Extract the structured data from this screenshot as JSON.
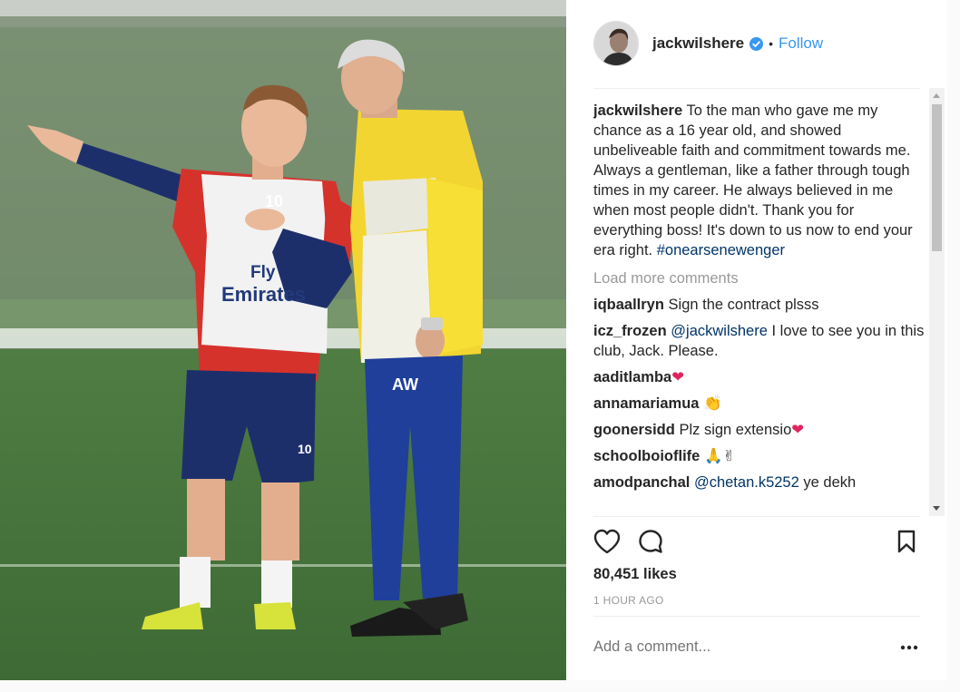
{
  "post": {
    "username": "jackwilshere",
    "follow_label": "Follow",
    "separator": "•",
    "caption": {
      "username": "jackwilshere",
      "text": "To the man who gave me my chance as a 16 year old, and showed unbeliveable faith and commitment towards me. Always a gentleman, like a father through tough times in my career. He always believed in me when most people didn't. Thank you for everything boss! It's down to us now to end your era right.",
      "hashtag": "#onearsenewenger"
    },
    "load_more_label": "Load more comments",
    "comments": [
      {
        "user": "iqbaallryn",
        "text": "Sign the contract plsss"
      },
      {
        "user": "icz_frozen",
        "mention": "@jackwilshere",
        "text": "I love to see you in this club, Jack. Please."
      },
      {
        "user": "aaditlamba",
        "emoji": "❤"
      },
      {
        "user": "annamariamua",
        "emoji": "👏"
      },
      {
        "user": "goonersidd",
        "text": "Plz sign extensio",
        "emoji": "❤"
      },
      {
        "user": "schoolboioflife",
        "emoji": "🙏✌"
      },
      {
        "user": "amodpanchal",
        "mention": "@chetan.k5252",
        "text": "ye dekh"
      }
    ],
    "likes": "80,451 likes",
    "time_ago": "1 HOUR AGO",
    "add_comment_placeholder": "Add a comment...",
    "photo_text": {
      "jersey_sponsor_line1": "Fly",
      "jersey_sponsor_line2": "Emirates",
      "shirt_number": "10",
      "shorts_number": "10",
      "trainer_initials": "AW"
    }
  },
  "colors": {
    "link_blue": "#3897f0",
    "verified_blue": "#3897f0",
    "hashtag": "#003569",
    "muted": "#999999",
    "heart_red": "#e0245e"
  },
  "icons": {
    "like": "heart-icon",
    "comment": "comment-bubble-icon",
    "save": "bookmark-icon",
    "more": "ellipsis-icon",
    "verified": "verified-badge-icon"
  }
}
